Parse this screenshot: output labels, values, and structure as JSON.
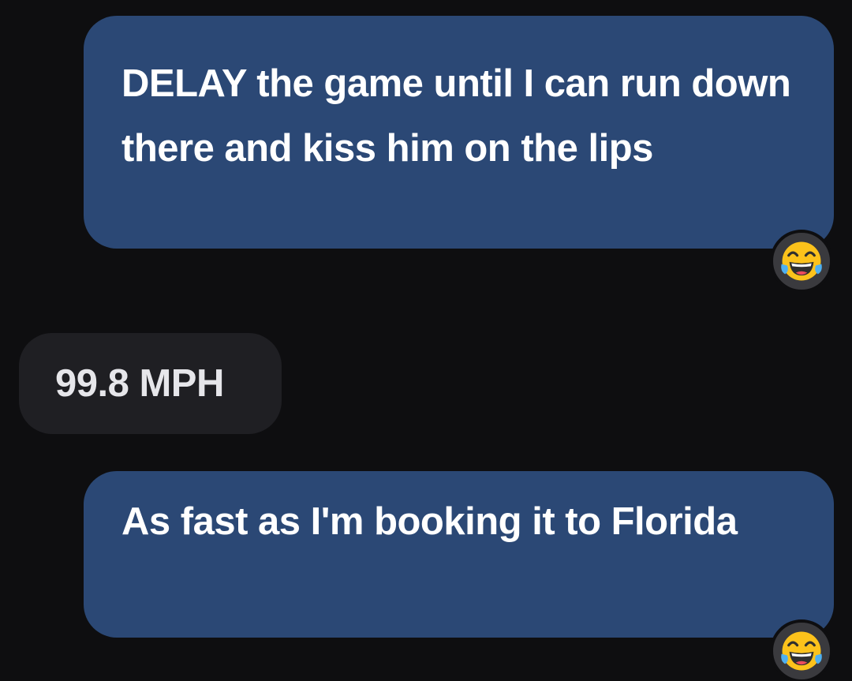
{
  "messages": [
    {
      "direction": "sent",
      "text": "DELAY the game until I can run down there and kiss him on the lips",
      "reaction": "face-with-tears-of-joy-icon"
    },
    {
      "direction": "received",
      "text": "99.8 MPH"
    },
    {
      "direction": "sent",
      "text": "As fast as I'm booking it to Florida",
      "reaction": "face-with-tears-of-joy-icon"
    }
  ],
  "colors": {
    "background": "#0e0e10",
    "sent_bubble": "#2b4875",
    "received_bubble": "#1f1f23",
    "reaction_badge": "#3a3a3e"
  }
}
